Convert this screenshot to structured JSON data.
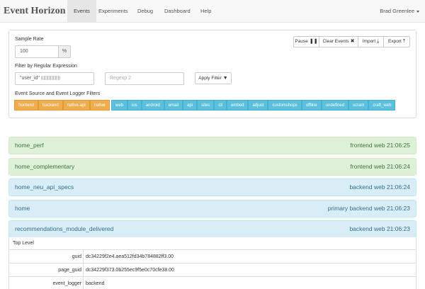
{
  "navbar": {
    "brand": "Event Horizon",
    "items": [
      {
        "label": "Events",
        "active": true
      },
      {
        "label": "Experiments"
      },
      {
        "label": "Debug"
      },
      {
        "label": "Dashboard"
      },
      {
        "label": "Help"
      }
    ],
    "user": "Brad Greenlee"
  },
  "controls": {
    "sample_rate_label": "Sample Rate",
    "sample_rate_value": "100",
    "sample_rate_unit": "%",
    "regex_label": "Filter by Regular Expression",
    "regex_value": "\"user_id\"",
    "regex2_placeholder": "Regexp 2",
    "apply_filter": "Apply Filter",
    "sources_label": "Event Source and Event Logger Filters",
    "buttons": {
      "pause": "Pause",
      "clear": "Clear Events",
      "import": "Import",
      "export": "Export"
    },
    "sources": [
      "frontend",
      "backend",
      "native-api",
      "native"
    ],
    "loggers": [
      "web",
      "ios",
      "android",
      "email",
      "api",
      "sites",
      "cli",
      "embed",
      "adjust",
      "customshops",
      "offline",
      "undefined",
      "scram",
      "craft_web"
    ],
    "colors": {
      "source": "#f0ad4e",
      "logger": "#5bc0de"
    }
  },
  "events": [
    {
      "name": "home_perf",
      "meta": "frontend web 21:06:25",
      "style": "green"
    },
    {
      "name": "home_complementary",
      "meta": "frontend web 21:06:24",
      "style": "green"
    },
    {
      "name": "home_neu_api_specs",
      "meta": "backend web 21:06:24",
      "style": "blue"
    },
    {
      "name": "home",
      "meta": "primary backend web 21:06:23",
      "style": "blue"
    },
    {
      "name": "recommendations_module_delivered",
      "meta": "backend web 21:06:23",
      "style": "blue"
    }
  ],
  "detail": {
    "heading": "Top Level",
    "rows": [
      {
        "key": "guid",
        "value": "dc34229f2e4.aea512fd34b784882ff3.00"
      },
      {
        "key": "page_guid",
        "value": "dc34229f373.0b255ec9f5e0c70cfe38.00"
      },
      {
        "key": "event_logger",
        "value": "backend"
      }
    ]
  }
}
